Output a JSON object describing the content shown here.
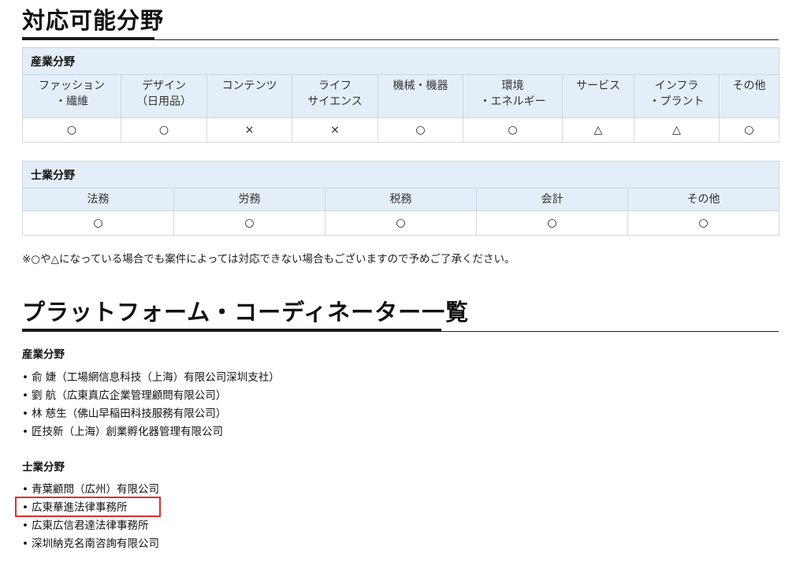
{
  "section1": {
    "title": "対応可能分野",
    "industry_table": {
      "caption": "産業分野",
      "headers": [
        [
          "ファッション",
          "・繊維"
        ],
        [
          "デザイン",
          "（日用品）"
        ],
        [
          "コンテンツ",
          ""
        ],
        [
          "ライフ",
          "サイエンス"
        ],
        [
          "機械・機器",
          ""
        ],
        [
          "環境",
          "・エネルギー"
        ],
        [
          "サービス",
          ""
        ],
        [
          "インフラ",
          "・プラント"
        ],
        [
          "その他",
          ""
        ]
      ],
      "values": [
        "○",
        "○",
        "×",
        "×",
        "○",
        "○",
        "△",
        "△",
        "○"
      ]
    },
    "professional_table": {
      "caption": "士業分野",
      "headers": [
        "法務",
        "労務",
        "税務",
        "会計",
        "その他"
      ],
      "values": [
        "○",
        "○",
        "○",
        "○",
        "○"
      ]
    },
    "note": "※○や△になっている場合でも案件によっては対応できない場合もございますので予めご了承ください。"
  },
  "section2": {
    "title": "プラットフォーム・コーディネーター一覧",
    "industry": {
      "heading": "産業分野",
      "items": [
        "俞 婕（工場網信息科技（上海）有限公司深圳支社）",
        "劉 航（広東真広企業管理顧問有限公司）",
        "林 慈生（佛山早稲田科技服務有限公司）",
        "匠技新（上海）創業孵化器管理有限公司"
      ]
    },
    "professional": {
      "heading": "士業分野",
      "items": [
        "青葉顧問（広州）有限公司",
        "広東華進法律事務所",
        "広東広信君達法律事務所",
        "深圳納克名南咨詢有限公司"
      ]
    }
  },
  "colors": {
    "table_header_bg": "#e4eef8",
    "highlight_border": "#e52b2b"
  }
}
